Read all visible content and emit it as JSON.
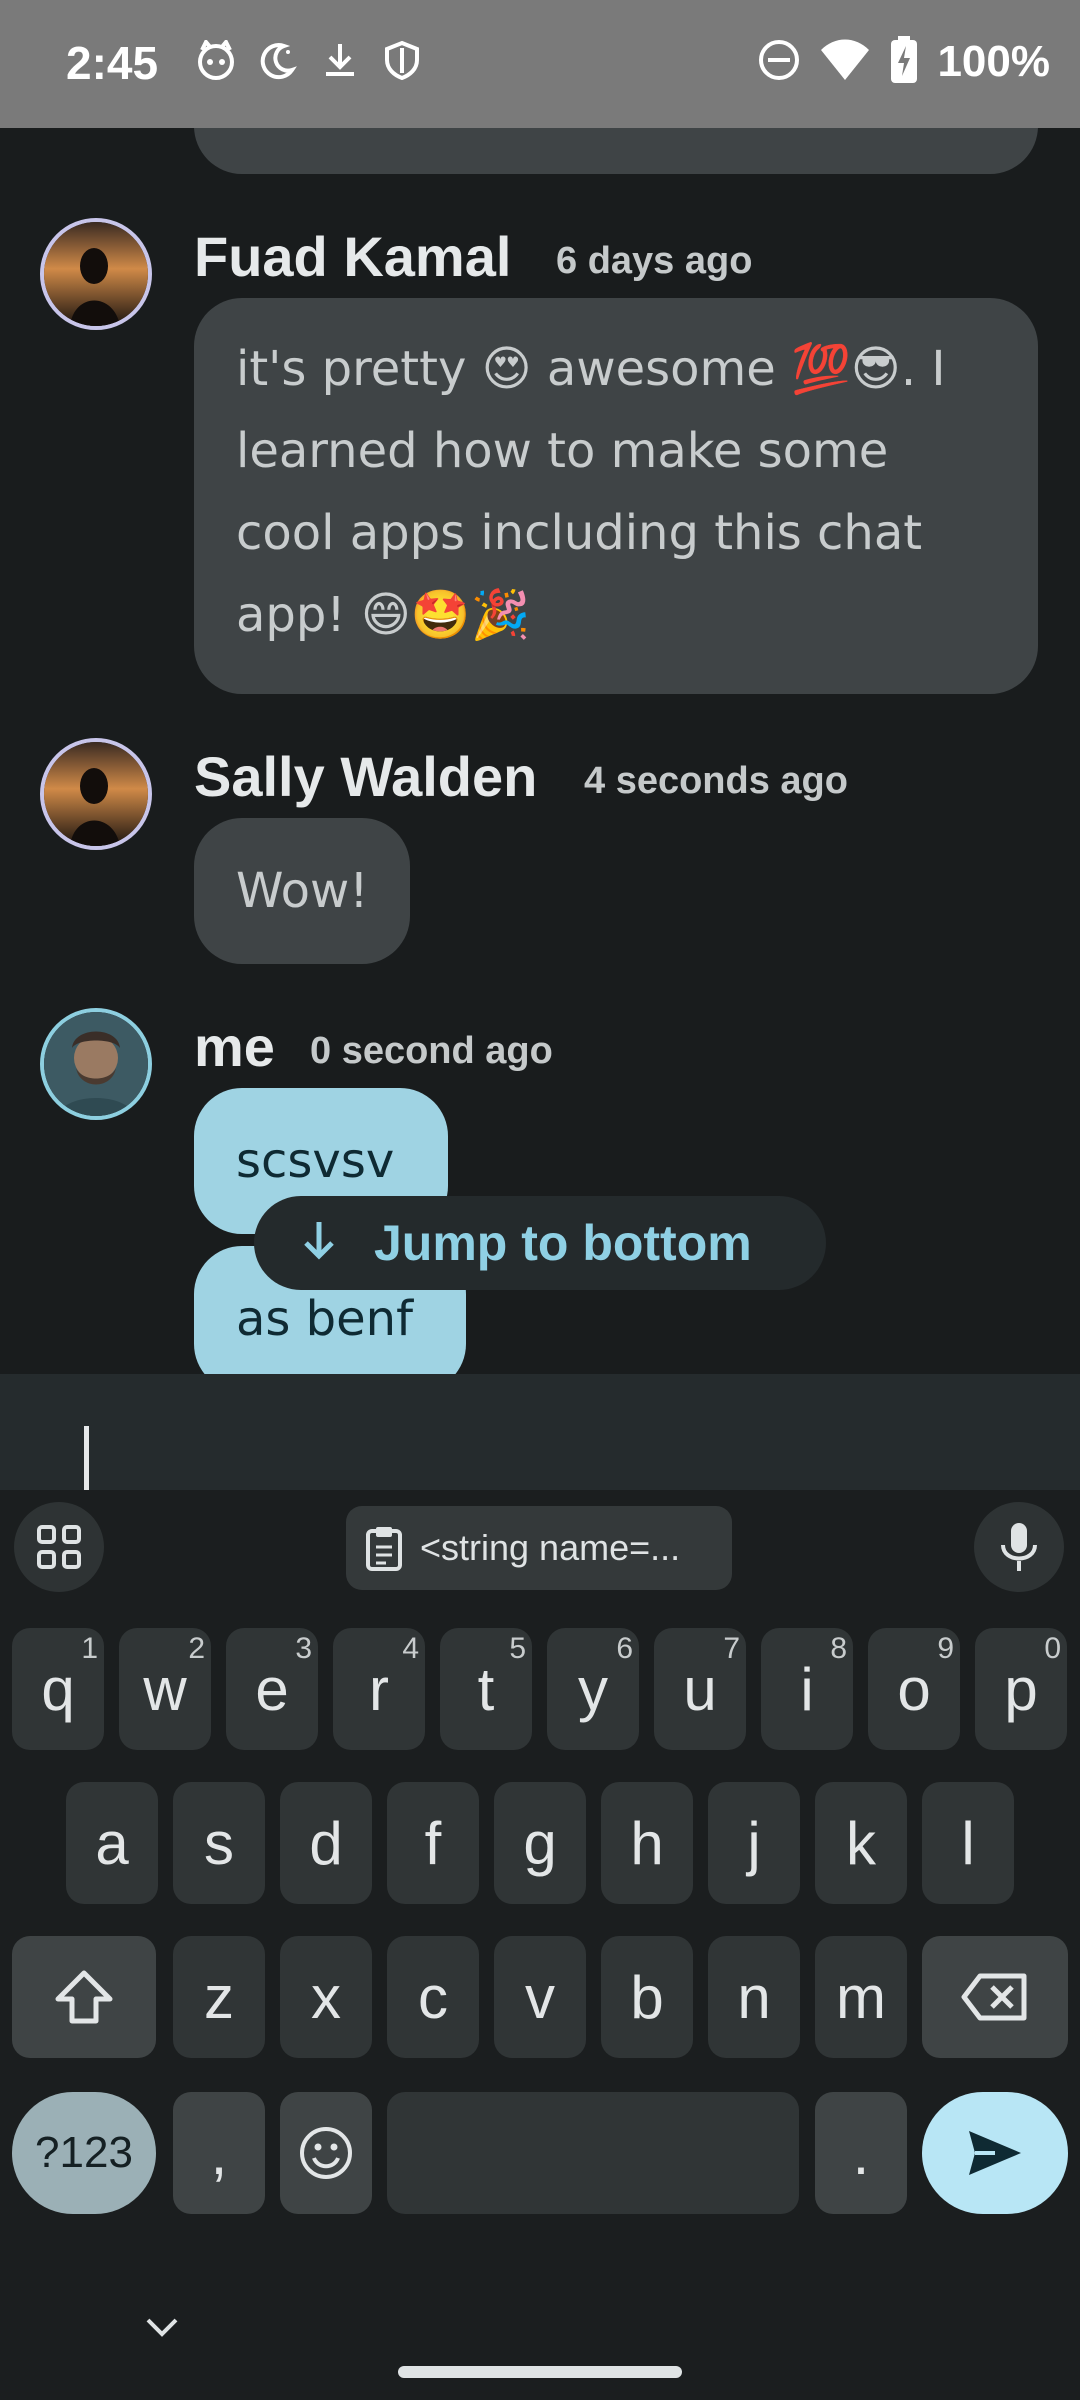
{
  "status_bar": {
    "time": "2:45",
    "battery_text": "100%",
    "left_icons": [
      "cat-notification-icon",
      "night-mode-icon",
      "download-icon",
      "shield-icon"
    ],
    "right_icons": [
      "do-not-disturb-icon",
      "wifi-icon",
      "battery-charging-icon"
    ]
  },
  "messages": [
    {
      "author": "Fuad Kamal",
      "timestamp": "6 days ago",
      "lines": [
        "it's pretty 😍 awesome 💯😎. I",
        "learned how to make some",
        "cool apps including this chat",
        "app! 😄🤩🎉"
      ]
    },
    {
      "author": "Sally Walden",
      "timestamp": "4 seconds ago",
      "text": "Wow!"
    },
    {
      "author": "me",
      "timestamp": "0 second ago",
      "texts": [
        "scsvsv",
        "as benf"
      ]
    }
  ],
  "jump_button": {
    "label": "Jump to bottom"
  },
  "keyboard": {
    "clipboard_suggestion": "<string name=...",
    "row1": [
      {
        "k": "q",
        "n": "1"
      },
      {
        "k": "w",
        "n": "2"
      },
      {
        "k": "e",
        "n": "3"
      },
      {
        "k": "r",
        "n": "4"
      },
      {
        "k": "t",
        "n": "5"
      },
      {
        "k": "y",
        "n": "6"
      },
      {
        "k": "u",
        "n": "7"
      },
      {
        "k": "i",
        "n": "8"
      },
      {
        "k": "o",
        "n": "9"
      },
      {
        "k": "p",
        "n": "0"
      }
    ],
    "row2": [
      "a",
      "s",
      "d",
      "f",
      "g",
      "h",
      "j",
      "k",
      "l"
    ],
    "row3": [
      "z",
      "x",
      "c",
      "v",
      "b",
      "n",
      "m"
    ],
    "symbols_label": "?123",
    "comma": ",",
    "period": "."
  },
  "colors": {
    "other_bubble": "#3f4446",
    "my_bubble": "#9fd3e3",
    "accent": "#8fd0e4"
  }
}
